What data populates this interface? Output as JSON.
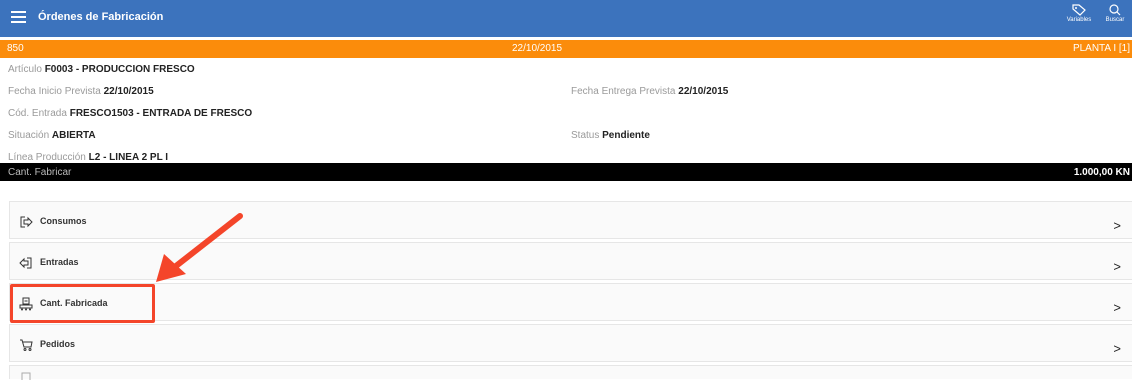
{
  "header": {
    "title": "Órdenes de Fabricación",
    "tools": [
      {
        "label": "Variables",
        "icon": "tag-icon"
      },
      {
        "label": "Buscar",
        "icon": "search-icon"
      }
    ]
  },
  "order_bar": {
    "number": "850",
    "date": "22/10/2015",
    "plant": "PLANTA I [1]"
  },
  "details": {
    "articulo": {
      "label": "Artículo",
      "value": "F0003 - PRODUCCION FRESCO"
    },
    "fecha_inicio": {
      "label": "Fecha Inicio Prevista",
      "value": "22/10/2015"
    },
    "fecha_entrega": {
      "label": "Fecha Entrega Prevista",
      "value": "22/10/2015"
    },
    "cod_entrada": {
      "label": "Cód. Entrada",
      "value": "FRESCO1503 - ENTRADA DE FRESCO"
    },
    "situacion": {
      "label": "Situación",
      "value": "ABIERTA"
    },
    "status": {
      "label": "Status",
      "value": "Pendiente"
    },
    "linea": {
      "label": "Línea Producción",
      "value": "L2 - LINEA 2 PL I"
    }
  },
  "quantity_bar": {
    "label": "Cant. Fabricar",
    "value": "1.000,00 KN"
  },
  "menu": {
    "items": [
      {
        "label": "Consumos",
        "chevron": ">"
      },
      {
        "label": "Entradas",
        "chevron": ">"
      },
      {
        "label": "Cant. Fabricada",
        "chevron": ">"
      },
      {
        "label": "Pedidos",
        "chevron": ">"
      }
    ]
  },
  "colors": {
    "header_blue": "#3c73bd",
    "order_orange": "#fb8c0b",
    "annotation_red": "#f4452a"
  }
}
